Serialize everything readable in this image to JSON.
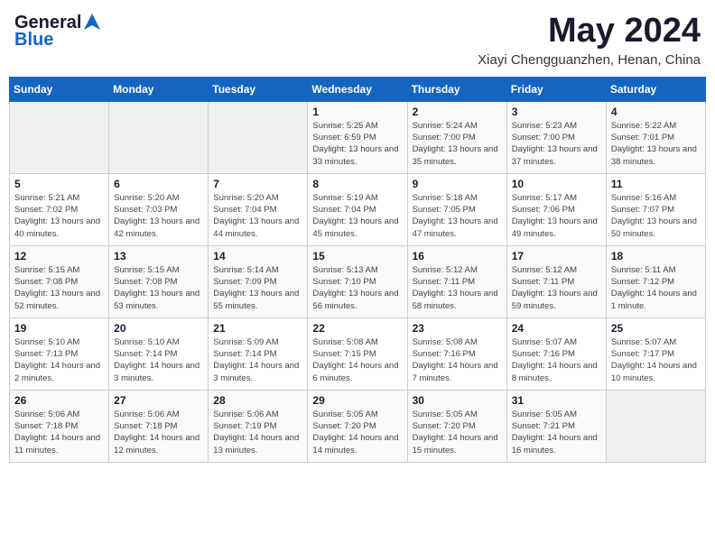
{
  "header": {
    "logo_general": "General",
    "logo_blue": "Blue",
    "month": "May 2024",
    "location": "Xiayi Chengguanzhen, Henan, China"
  },
  "weekdays": [
    "Sunday",
    "Monday",
    "Tuesday",
    "Wednesday",
    "Thursday",
    "Friday",
    "Saturday"
  ],
  "weeks": [
    [
      {
        "day": "",
        "sunrise": "",
        "sunset": "",
        "daylight": ""
      },
      {
        "day": "",
        "sunrise": "",
        "sunset": "",
        "daylight": ""
      },
      {
        "day": "",
        "sunrise": "",
        "sunset": "",
        "daylight": ""
      },
      {
        "day": "1",
        "sunrise": "Sunrise: 5:25 AM",
        "sunset": "Sunset: 6:59 PM",
        "daylight": "Daylight: 13 hours and 33 minutes."
      },
      {
        "day": "2",
        "sunrise": "Sunrise: 5:24 AM",
        "sunset": "Sunset: 7:00 PM",
        "daylight": "Daylight: 13 hours and 35 minutes."
      },
      {
        "day": "3",
        "sunrise": "Sunrise: 5:23 AM",
        "sunset": "Sunset: 7:00 PM",
        "daylight": "Daylight: 13 hours and 37 minutes."
      },
      {
        "day": "4",
        "sunrise": "Sunrise: 5:22 AM",
        "sunset": "Sunset: 7:01 PM",
        "daylight": "Daylight: 13 hours and 38 minutes."
      }
    ],
    [
      {
        "day": "5",
        "sunrise": "Sunrise: 5:21 AM",
        "sunset": "Sunset: 7:02 PM",
        "daylight": "Daylight: 13 hours and 40 minutes."
      },
      {
        "day": "6",
        "sunrise": "Sunrise: 5:20 AM",
        "sunset": "Sunset: 7:03 PM",
        "daylight": "Daylight: 13 hours and 42 minutes."
      },
      {
        "day": "7",
        "sunrise": "Sunrise: 5:20 AM",
        "sunset": "Sunset: 7:04 PM",
        "daylight": "Daylight: 13 hours and 44 minutes."
      },
      {
        "day": "8",
        "sunrise": "Sunrise: 5:19 AM",
        "sunset": "Sunset: 7:04 PM",
        "daylight": "Daylight: 13 hours and 45 minutes."
      },
      {
        "day": "9",
        "sunrise": "Sunrise: 5:18 AM",
        "sunset": "Sunset: 7:05 PM",
        "daylight": "Daylight: 13 hours and 47 minutes."
      },
      {
        "day": "10",
        "sunrise": "Sunrise: 5:17 AM",
        "sunset": "Sunset: 7:06 PM",
        "daylight": "Daylight: 13 hours and 49 minutes."
      },
      {
        "day": "11",
        "sunrise": "Sunrise: 5:16 AM",
        "sunset": "Sunset: 7:07 PM",
        "daylight": "Daylight: 13 hours and 50 minutes."
      }
    ],
    [
      {
        "day": "12",
        "sunrise": "Sunrise: 5:15 AM",
        "sunset": "Sunset: 7:08 PM",
        "daylight": "Daylight: 13 hours and 52 minutes."
      },
      {
        "day": "13",
        "sunrise": "Sunrise: 5:15 AM",
        "sunset": "Sunset: 7:08 PM",
        "daylight": "Daylight: 13 hours and 53 minutes."
      },
      {
        "day": "14",
        "sunrise": "Sunrise: 5:14 AM",
        "sunset": "Sunset: 7:09 PM",
        "daylight": "Daylight: 13 hours and 55 minutes."
      },
      {
        "day": "15",
        "sunrise": "Sunrise: 5:13 AM",
        "sunset": "Sunset: 7:10 PM",
        "daylight": "Daylight: 13 hours and 56 minutes."
      },
      {
        "day": "16",
        "sunrise": "Sunrise: 5:12 AM",
        "sunset": "Sunset: 7:11 PM",
        "daylight": "Daylight: 13 hours and 58 minutes."
      },
      {
        "day": "17",
        "sunrise": "Sunrise: 5:12 AM",
        "sunset": "Sunset: 7:11 PM",
        "daylight": "Daylight: 13 hours and 59 minutes."
      },
      {
        "day": "18",
        "sunrise": "Sunrise: 5:11 AM",
        "sunset": "Sunset: 7:12 PM",
        "daylight": "Daylight: 14 hours and 1 minute."
      }
    ],
    [
      {
        "day": "19",
        "sunrise": "Sunrise: 5:10 AM",
        "sunset": "Sunset: 7:13 PM",
        "daylight": "Daylight: 14 hours and 2 minutes."
      },
      {
        "day": "20",
        "sunrise": "Sunrise: 5:10 AM",
        "sunset": "Sunset: 7:14 PM",
        "daylight": "Daylight: 14 hours and 3 minutes."
      },
      {
        "day": "21",
        "sunrise": "Sunrise: 5:09 AM",
        "sunset": "Sunset: 7:14 PM",
        "daylight": "Daylight: 14 hours and 3 minutes."
      },
      {
        "day": "22",
        "sunrise": "Sunrise: 5:08 AM",
        "sunset": "Sunset: 7:15 PM",
        "daylight": "Daylight: 14 hours and 6 minutes."
      },
      {
        "day": "23",
        "sunrise": "Sunrise: 5:08 AM",
        "sunset": "Sunset: 7:16 PM",
        "daylight": "Daylight: 14 hours and 7 minutes."
      },
      {
        "day": "24",
        "sunrise": "Sunrise: 5:07 AM",
        "sunset": "Sunset: 7:16 PM",
        "daylight": "Daylight: 14 hours and 8 minutes."
      },
      {
        "day": "25",
        "sunrise": "Sunrise: 5:07 AM",
        "sunset": "Sunset: 7:17 PM",
        "daylight": "Daylight: 14 hours and 10 minutes."
      }
    ],
    [
      {
        "day": "26",
        "sunrise": "Sunrise: 5:06 AM",
        "sunset": "Sunset: 7:18 PM",
        "daylight": "Daylight: 14 hours and 11 minutes."
      },
      {
        "day": "27",
        "sunrise": "Sunrise: 5:06 AM",
        "sunset": "Sunset: 7:18 PM",
        "daylight": "Daylight: 14 hours and 12 minutes."
      },
      {
        "day": "28",
        "sunrise": "Sunrise: 5:06 AM",
        "sunset": "Sunset: 7:19 PM",
        "daylight": "Daylight: 14 hours and 13 minutes."
      },
      {
        "day": "29",
        "sunrise": "Sunrise: 5:05 AM",
        "sunset": "Sunset: 7:20 PM",
        "daylight": "Daylight: 14 hours and 14 minutes."
      },
      {
        "day": "30",
        "sunrise": "Sunrise: 5:05 AM",
        "sunset": "Sunset: 7:20 PM",
        "daylight": "Daylight: 14 hours and 15 minutes."
      },
      {
        "day": "31",
        "sunrise": "Sunrise: 5:05 AM",
        "sunset": "Sunset: 7:21 PM",
        "daylight": "Daylight: 14 hours and 16 minutes."
      },
      {
        "day": "",
        "sunrise": "",
        "sunset": "",
        "daylight": ""
      }
    ]
  ]
}
